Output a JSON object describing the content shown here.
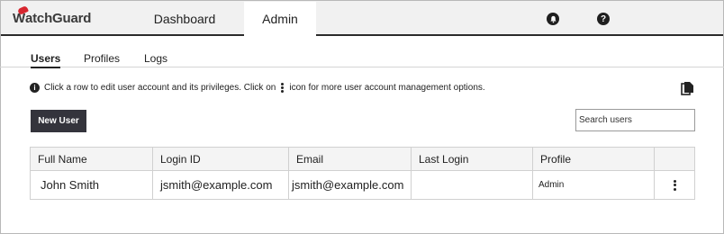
{
  "brand": {
    "logo_text": "atchGuard",
    "logo_initial": "W"
  },
  "topnav": {
    "tabs": [
      {
        "label": "Dashboard"
      },
      {
        "label": "Admin"
      }
    ]
  },
  "subnav": {
    "tabs": [
      {
        "label": "Users"
      },
      {
        "label": "Profiles"
      },
      {
        "label": "Logs"
      }
    ]
  },
  "info": {
    "text_before": "Click a row to edit user account and its privileges. Click on",
    "text_after": "icon for more user account management options."
  },
  "actions": {
    "new_user_label": "New User",
    "search_placeholder": "Search users"
  },
  "table": {
    "columns": [
      "Full Name",
      "Login ID",
      "Email",
      "Last Login",
      "Profile",
      ""
    ],
    "rows": [
      {
        "full_name": "John Smith",
        "login_id": "jsmith@example.com",
        "email": "jsmith@example.com",
        "last_login": "",
        "profile": "Admin"
      }
    ]
  },
  "colors": {
    "brand_red": "#d7262f",
    "primary_button": "#34343c",
    "topbar_bg": "#f1f1f1"
  }
}
